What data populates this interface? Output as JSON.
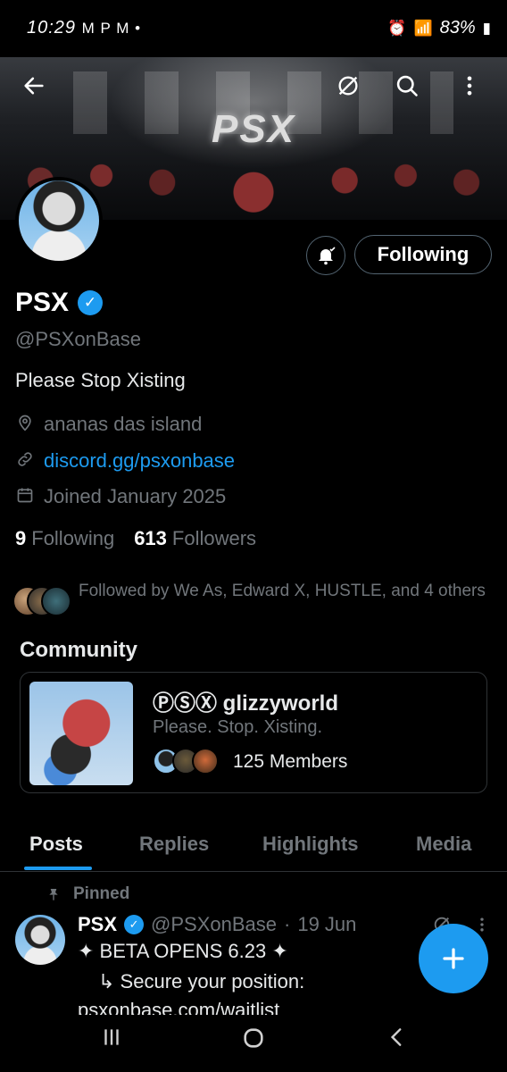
{
  "status_bar": {
    "time": "10:29",
    "left_icons": "M P M •",
    "battery": "83%"
  },
  "banner": {
    "logo_text": "PSX"
  },
  "profile": {
    "name": "PSX",
    "handle": "@PSXonBase",
    "bio": "Please Stop Xisting",
    "location": "ananas das island",
    "website": "discord.gg/psxonbase",
    "joined": "Joined January 2025",
    "following_count": "9",
    "following_label": "Following",
    "followers_count": "613",
    "followers_label": "Followers",
    "following_button": "Following",
    "followed_by": "Followed by We As, Edward X, HUSTLE, and 4 others"
  },
  "community": {
    "section_title": "Community",
    "name": "ⓅⓈⓍ glizzyworld",
    "description": "Please. Stop. Xisting.",
    "members": "125 Members"
  },
  "tabs": [
    "Posts",
    "Replies",
    "Highlights",
    "Media"
  ],
  "pinned_post": {
    "pinned_label": "Pinned",
    "author_name": "PSX",
    "author_handle": "@PSXonBase",
    "dot": "·",
    "date": "19 Jun",
    "line1": "✦ BETA OPENS 6.23 ✦",
    "line2": "↳ Secure your position:",
    "line3": "psxonbase.com/waitlist"
  },
  "colors": {
    "accent": "#1d9bf0",
    "muted_text": "#71767b",
    "primary_text": "#e7e9ea",
    "border": "#2f3336",
    "background": "#000000"
  },
  "icons": {
    "back": "arrow-left-icon",
    "grok": "grok-icon",
    "search": "search-icon",
    "more": "more-vertical-icon",
    "bell": "bell-icon",
    "location": "location-pin-icon",
    "link": "link-icon",
    "calendar": "calendar-icon",
    "pin": "pin-icon",
    "compose": "plus-icon"
  }
}
